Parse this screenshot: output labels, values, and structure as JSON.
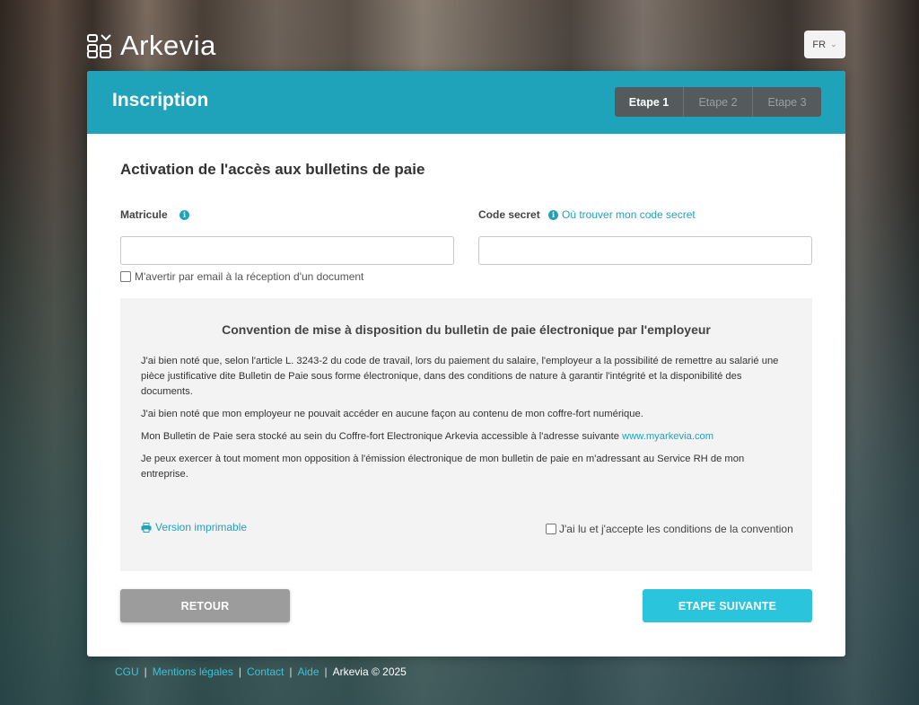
{
  "brand": {
    "name": "Arkevia",
    "logo_icon": "arkevia-logo-icon"
  },
  "language": {
    "selected": "FR",
    "icon": "chevron-down-icon"
  },
  "card": {
    "title": "Inscription",
    "steps": [
      {
        "label": "Etape 1",
        "active": true
      },
      {
        "label": "Etape 2",
        "active": false
      },
      {
        "label": "Etape 3",
        "active": false
      }
    ]
  },
  "form": {
    "section_title": "Activation de l'accès aux bulletins de paie",
    "matricule_label": "Matricule",
    "matricule_value": "",
    "code_label": "Code secret",
    "code_help_link": "Où trouver mon code secret",
    "code_value": "",
    "notify_label": "M'avertir par email à la réception d'un document"
  },
  "convention": {
    "title": "Convention de mise à disposition du bulletin de paie électronique par l'employeur",
    "p1": "J'ai bien noté que, selon l'article L. 3243-2 du code de travail, lors du paiement du salaire, l'employeur a la possibilité de remettre au salarié une pièce justificative dite Bulletin de Paie sous forme électronique, dans des conditions de nature à garantir l'intégrité et la disponibilité des documents.",
    "p2": "J'ai bien noté que mon employeur ne pouvait accéder en aucune façon au contenu de mon coffre-fort numérique.",
    "p3": "Mon Bulletin de Paie sera stocké au sein du Coffre-fort Electronique Arkevia accessible à l'adresse suivante",
    "p3_link": "www.myarkevia.com",
    "p4": "Je peux exercer à tout moment mon opposition à l'émission électronique de mon bulletin de paie en m'adressant au Service RH de mon entreprise.",
    "print_link": "Version imprimable",
    "accept_label": "J'ai lu et j'accepte les conditions de la convention"
  },
  "buttons": {
    "back": "RETOUR",
    "next": "ETAPE SUIVANTE"
  },
  "footer": {
    "links": [
      "CGU",
      "Mentions légales",
      "Contact",
      "Aide"
    ],
    "copyright": "Arkevia © 2025"
  },
  "colors": {
    "accent": "#1fa3bb",
    "next_button": "#2ac4dd",
    "back_button": "#9c9c9c"
  }
}
